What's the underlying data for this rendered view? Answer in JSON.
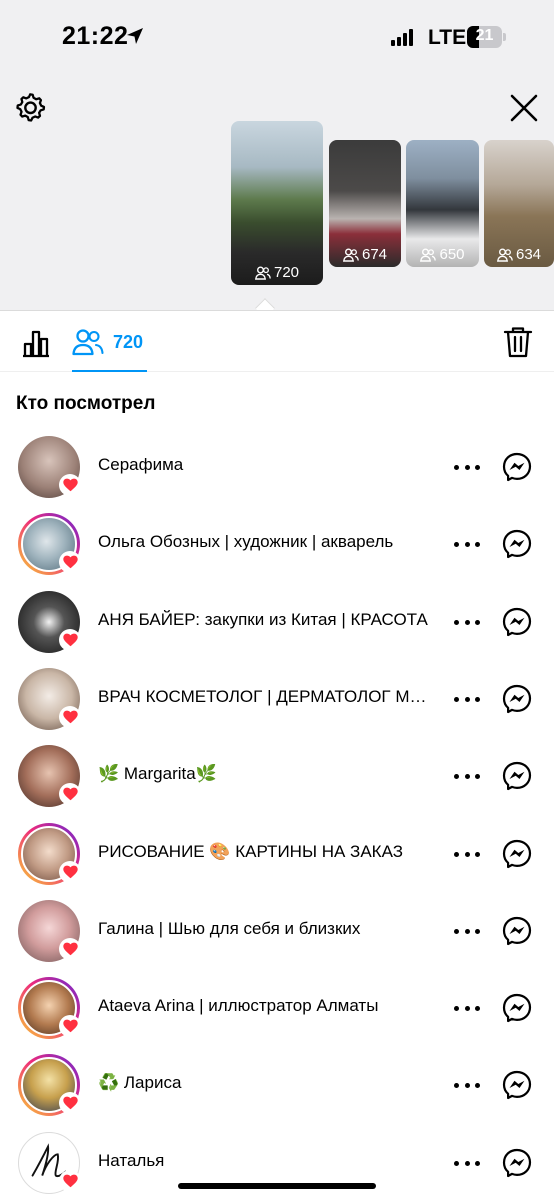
{
  "status_bar": {
    "time": "21:22",
    "network": "LTE",
    "battery": "21"
  },
  "icons": {
    "settings": "gear-icon",
    "close": "close-icon",
    "stats": "bar-chart-icon",
    "viewers": "people-icon",
    "delete": "trash-icon",
    "messenger": "messenger-icon",
    "more": "more-horizontal-icon",
    "like": "heart-icon"
  },
  "colors": {
    "accent": "#0095f6",
    "heart": "#ff3040",
    "top_background": "#f0f0f2"
  },
  "stories": [
    {
      "views": "720",
      "selected": true
    },
    {
      "views": "674"
    },
    {
      "views": "650"
    },
    {
      "views": "634"
    }
  ],
  "tabs": {
    "viewers_count": "720"
  },
  "section_title": "Кто посмотрел",
  "viewers": [
    {
      "name": "Серафима",
      "ring": false
    },
    {
      "name": "Ольга Обозных | художник | акварель",
      "ring": true
    },
    {
      "name": "АНЯ БАЙЕР: закупки из Китая | КРАСОТА",
      "ring": false
    },
    {
      "name": "ВРАЧ КОСМЕТОЛОГ | ДЕРМАТОЛОГ МОСКВА",
      "ring": false
    },
    {
      "name": "🌿 Margarita🌿",
      "ring": false
    },
    {
      "name": "РИСОВАНИЕ 🎨 КАРТИНЫ НА ЗАКАЗ",
      "ring": true
    },
    {
      "name": "Галина | Шью для себя и близких",
      "ring": false
    },
    {
      "name": "Ataeva Arina | иллюстратор Алматы",
      "ring": true
    },
    {
      "name": "♻️ Лариса",
      "ring": true
    },
    {
      "name": "Наталья",
      "ring": false
    }
  ]
}
